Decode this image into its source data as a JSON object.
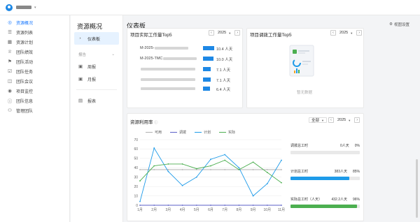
{
  "user": {
    "name": "▆▆▆▆"
  },
  "sidebar": {
    "items": [
      {
        "label": "资源概况",
        "icon": "compass-icon",
        "active": true
      },
      {
        "label": "资源列表",
        "icon": "list-icon"
      },
      {
        "label": "资源计划",
        "icon": "calendar-icon"
      },
      {
        "label": "团队绩效",
        "icon": "trophy-icon"
      },
      {
        "label": "团队活动",
        "icon": "activity-icon"
      },
      {
        "label": "团队任务",
        "icon": "task-icon"
      },
      {
        "label": "团队会议",
        "icon": "meeting-icon"
      },
      {
        "label": "项目监控",
        "icon": "monitor-icon"
      },
      {
        "label": "团队信息",
        "icon": "info-icon"
      },
      {
        "label": "管理团队",
        "icon": "team-icon"
      }
    ]
  },
  "subnav": {
    "title": "资源概况",
    "dashboard": "仪表板",
    "group": "报告",
    "weekly": "周报",
    "monthly": "月报",
    "report": "报表"
  },
  "page": {
    "title": "仪表板",
    "settings": "视图设置"
  },
  "top5": {
    "title": "项目实际工作量Top5",
    "year": "2025",
    "rows": [
      {
        "name": "M-2025-",
        "value": 10.4,
        "label": "10.4 人天"
      },
      {
        "name": "M-2025-TMC",
        "value": 10.0,
        "label": "10.0 人天"
      },
      {
        "name": "",
        "value": 7.1,
        "label": "7.1 人天"
      },
      {
        "name": "",
        "value": 7.1,
        "label": "7.1 人天"
      },
      {
        "name": "",
        "value": 6.4,
        "label": "6.4 人天"
      }
    ]
  },
  "adjust": {
    "title": "项目调拨工作量Top5",
    "year": "2025",
    "empty": "暂无数据"
  },
  "util": {
    "title": "资源利用率",
    "filter": "全部",
    "year": "2025",
    "legend": [
      {
        "name": "可用",
        "color": "#b0b0b0"
      },
      {
        "name": "调拨",
        "color": "#5b5fc7"
      },
      {
        "name": "计划",
        "color": "#1e9be9"
      },
      {
        "name": "实际",
        "color": "#4caf50"
      }
    ],
    "stats": [
      {
        "label": "调拨总工时",
        "value": "0人天",
        "pct": "0%",
        "fill": 0,
        "color": "#5b5fc7"
      },
      {
        "label": "计划总工时",
        "value": "383人天",
        "pct": "85%",
        "fill": 0.85,
        "color": "#1e9be9"
      },
      {
        "label": "实际总工时（人天）",
        "value": "432.2人天",
        "pct": "96%",
        "fill": 0.96,
        "color": "#4caf50"
      }
    ]
  },
  "chart_data": {
    "type": "line",
    "categories": [
      "1月",
      "2月",
      "3月",
      "4月",
      "5月",
      "6月",
      "7月",
      "8月",
      "9月",
      "10月",
      "11月"
    ],
    "ylim": [
      0,
      70
    ],
    "yticks": [
      0,
      10,
      20,
      30,
      40,
      50,
      60,
      70
    ],
    "series": [
      {
        "name": "可用",
        "color": "#b0b0b0",
        "values": [
          38,
          38,
          38,
          38,
          38,
          38,
          38,
          38,
          38,
          38,
          38
        ]
      },
      {
        "name": "调拨",
        "color": "#5b5fc7",
        "values": [
          0,
          0,
          0,
          0,
          0,
          0,
          0,
          0,
          0,
          0,
          0
        ]
      },
      {
        "name": "计划",
        "color": "#1e9be9",
        "values": [
          4,
          61,
          36,
          21,
          30,
          49,
          54,
          40,
          10,
          23,
          48
        ]
      },
      {
        "name": "实际",
        "color": "#4caf50",
        "values": [
          26,
          42,
          44,
          44,
          39,
          42,
          48,
          38,
          46,
          35,
          24
        ]
      }
    ]
  }
}
